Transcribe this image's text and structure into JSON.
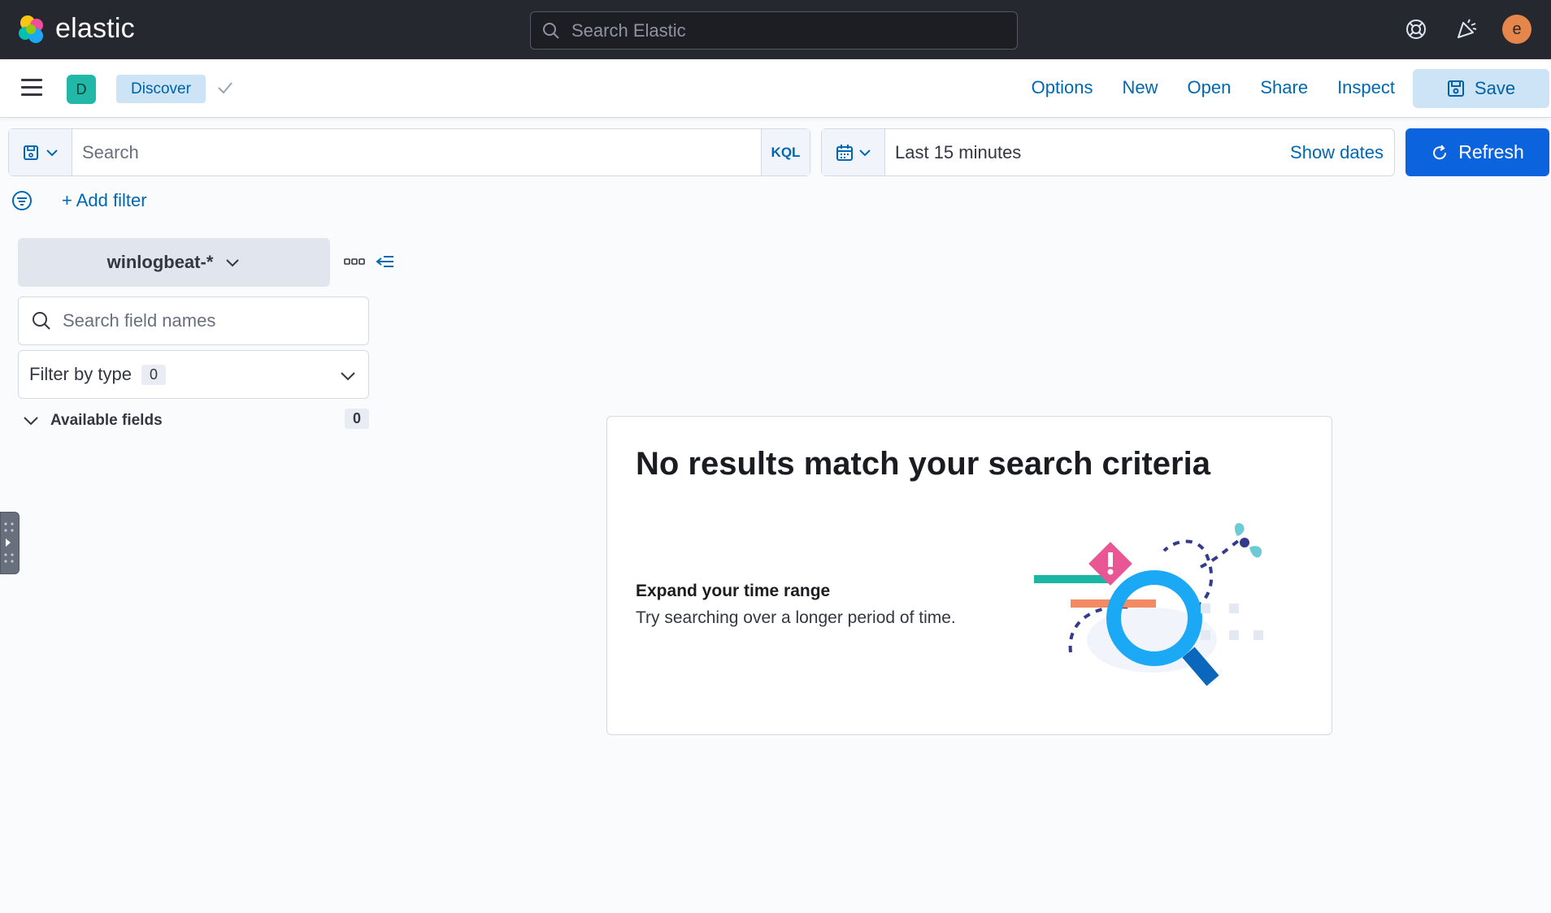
{
  "header": {
    "brand": "elastic",
    "search_placeholder": "Search Elastic",
    "avatar_initial": "e"
  },
  "navbar": {
    "space_initial": "D",
    "breadcrumb": "Discover",
    "links": [
      "Options",
      "New",
      "Open",
      "Share",
      "Inspect"
    ],
    "save_label": "Save"
  },
  "query": {
    "placeholder": "Search",
    "language": "KQL",
    "time_range": "Last 15 minutes",
    "show_dates": "Show dates",
    "refresh_label": "Refresh",
    "add_filter": "+ Add filter"
  },
  "sidebar": {
    "index_pattern": "winlogbeat-*",
    "field_search_placeholder": "Search field names",
    "filter_by_type": "Filter by type",
    "filter_count": "0",
    "available_fields": "Available fields",
    "available_count": "0"
  },
  "empty_state": {
    "title": "No results match your search criteria",
    "subtitle": "Expand your time range",
    "body": "Try searching over a longer period of time."
  },
  "colors": {
    "header_bg": "#25282f",
    "primary": "#0b64dd",
    "link": "#0068b3",
    "breadcrumb_bg": "#cce4f5",
    "space_badge": "#21b8a7",
    "avatar": "#e7864a"
  }
}
